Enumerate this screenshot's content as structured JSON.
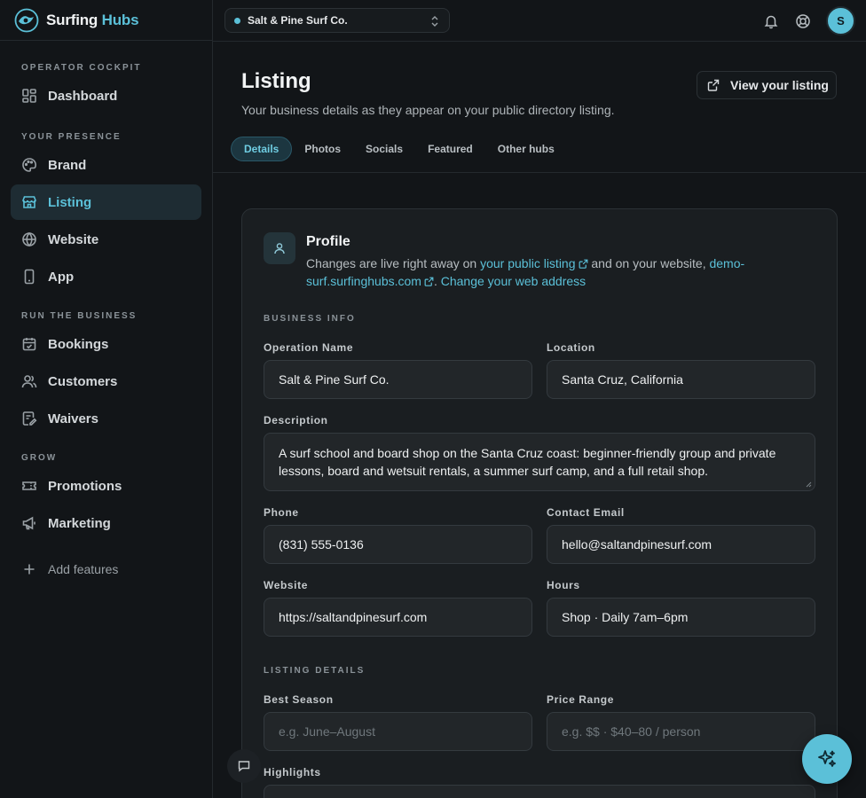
{
  "brand": {
    "name_part1": "Surfing",
    "name_part2": "Hubs"
  },
  "business_selector": {
    "value": "Salt & Pine Surf Co."
  },
  "user": {
    "avatar_initial": "S"
  },
  "sidebar": {
    "sections": [
      {
        "label": "OPERATOR COCKPIT"
      },
      {
        "label": "YOUR PRESENCE"
      },
      {
        "label": "RUN THE BUSINESS"
      },
      {
        "label": "GROW"
      }
    ],
    "items": [
      {
        "label": "Dashboard",
        "icon": "dashboard-icon"
      },
      {
        "label": "Brand",
        "icon": "palette-icon"
      },
      {
        "label": "Listing",
        "icon": "store-icon"
      },
      {
        "label": "Website",
        "icon": "globe-icon"
      },
      {
        "label": "App",
        "icon": "phone-icon"
      },
      {
        "label": "Bookings",
        "icon": "calendar-icon"
      },
      {
        "label": "Customers",
        "icon": "users-icon"
      },
      {
        "label": "Waivers",
        "icon": "waiver-icon"
      },
      {
        "label": "Promotions",
        "icon": "ticket-icon"
      },
      {
        "label": "Marketing",
        "icon": "megaphone-icon"
      },
      {
        "label": "Add features",
        "icon": "plus-icon"
      }
    ]
  },
  "header": {
    "title": "Listing",
    "subtitle": "Your business details as they appear on your public directory listing.",
    "view_button": "View your listing"
  },
  "tabs": [
    "Details",
    "Photos",
    "Socials",
    "Featured",
    "Other hubs"
  ],
  "profile": {
    "title": "Profile",
    "desc_1": "Changes are live right away on ",
    "link_listing": "your public listing",
    "desc_2": " and on your website, ",
    "link_site": "demo-surf.surfinghubs.com",
    "desc_3": ". ",
    "link_change": "Change your web address"
  },
  "business_info": {
    "label": "BUSINESS INFO",
    "operation_name_label": "Operation Name",
    "operation_name": "Salt & Pine Surf Co.",
    "location_label": "Location",
    "location": "Santa Cruz, California",
    "description_label": "Description",
    "description": "A surf school and board shop on the Santa Cruz coast: beginner-friendly group and private lessons, board and wetsuit rentals, a summer surf camp, and a full retail shop.",
    "phone_label": "Phone",
    "phone": "(831) 555-0136",
    "email_label": "Contact Email",
    "email": "hello@saltandpinesurf.com",
    "website_label": "Website",
    "website": "https://saltandpinesurf.com",
    "hours_label": "Hours",
    "hours": "Shop · Daily 7am–6pm"
  },
  "listing_details": {
    "label": "LISTING DETAILS",
    "best_season_label": "Best Season",
    "best_season_placeholder": "e.g. June–August",
    "price_range_label": "Price Range",
    "price_range_placeholder": "e.g. $$ · $40–80 / person",
    "highlights_label": "Highlights"
  },
  "colors": {
    "accent": "#5bc0d8",
    "background": "#121518",
    "card": "#1a1e21"
  }
}
